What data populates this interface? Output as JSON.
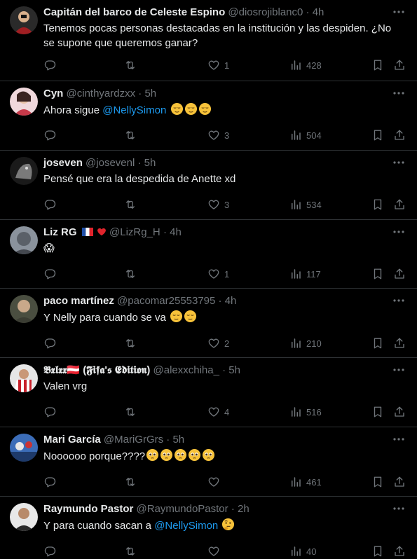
{
  "tweets": [
    {
      "name": "Capitán del barco de Celeste Espino",
      "handle": "@diosrojiblanc0",
      "time": "4h",
      "text": "Tenemos pocas personas destacadas en la institución y las despiden. ¿No se supone que queremos ganar?",
      "replies": "",
      "retweets": "",
      "likes": "1",
      "views": "428",
      "avatar_color": "#8a1c1c"
    },
    {
      "name": "Cyn",
      "handle": "@cinthyardzxx",
      "time": "5h",
      "text_before": "Ahora sigue ",
      "mention": "@NellySimon",
      "text_after": " ",
      "emoji_count": 3,
      "likes": "3",
      "views": "504",
      "avatar_color": "#c73a4a"
    },
    {
      "name": "joseven",
      "handle": "@josevenl",
      "time": "5h",
      "text": "Pensé que era la despedida de Anette xd",
      "likes": "3",
      "views": "534",
      "avatar_color": "#3a3a3a"
    },
    {
      "name": "Liz RG",
      "handle": "@LizRg_H",
      "time": "4h",
      "text": "😱",
      "likes": "1",
      "views": "117",
      "avatar_color": "#6b7480"
    },
    {
      "name": "paco martínez",
      "handle": "@pacomar25553795",
      "time": "4h",
      "text": "Y Nelly para cuando se va ",
      "emoji_count": 2,
      "likes": "2",
      "views": "210",
      "avatar_color": "#6a6a5a"
    },
    {
      "name": "𝕭𝖝𝖑𝖝𝖝🇦🇹 (𝕱𝖎𝖋𝖆'𝖘 𝕰𝖉𝖎𝖙𝖎𝖔𝖓)",
      "handle": "@alexxchiha_",
      "time": "5h",
      "text": "Valen vrg",
      "likes": "4",
      "views": "516",
      "avatar_color": "#b52a2a"
    },
    {
      "name": "Mari García",
      "handle": "@MariGrGrs",
      "time": "5h",
      "text": "Noooooo porque????",
      "emoji_count": 5,
      "likes": "",
      "views": "461",
      "avatar_color": "#2b4e8c"
    },
    {
      "name": "Raymundo Pastor",
      "handle": "@RaymundoPastor",
      "time": "2h",
      "text_before": "Y para cuando sacan a ",
      "mention": "@NellySimon",
      "text_after": " ",
      "likes": "",
      "views": "40",
      "avatar_color": "#d8d8d8"
    }
  ],
  "colors": {
    "background": "#000000",
    "text": "#e7e9ea",
    "muted": "#71767b",
    "link": "#1d9bf0",
    "border": "#2f3336"
  },
  "icons": {
    "reply": "reply-icon",
    "retweet": "retweet-icon",
    "like": "heart-icon",
    "views": "views-icon",
    "bookmark": "bookmark-icon",
    "share": "share-icon",
    "more": "more-icon"
  }
}
